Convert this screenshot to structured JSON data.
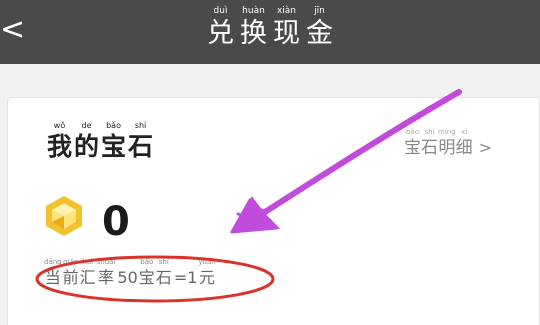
{
  "header": {
    "back_icon": "chevron-left-icon",
    "back_glyph": "<",
    "title": [
      {
        "py": "duì",
        "hz": "兑"
      },
      {
        "py": "huàn",
        "hz": "换"
      },
      {
        "py": "xiàn",
        "hz": "现"
      },
      {
        "py": "jīn",
        "hz": "金"
      }
    ]
  },
  "card": {
    "heading": [
      {
        "py": "wǒ",
        "hz": "我"
      },
      {
        "py": "de",
        "hz": "的"
      },
      {
        "py": "bǎo",
        "hz": "宝"
      },
      {
        "py": "shí",
        "hz": "石"
      }
    ],
    "detail_link": [
      {
        "py": "bǎo",
        "hz": "宝"
      },
      {
        "py": "shí",
        "hz": "石"
      },
      {
        "py": "míng",
        "hz": "明"
      },
      {
        "py": "xì",
        "hz": "细"
      }
    ],
    "detail_chevron": ">",
    "gem_icon": "gem-icon",
    "gem_count": "0",
    "rate": [
      {
        "py": "dāng",
        "hz": "当"
      },
      {
        "py": "qián",
        "hz": "前"
      },
      {
        "py": "huì",
        "hz": "汇"
      },
      {
        "py": "shuài",
        "hz": "率"
      },
      {
        "plain": "50"
      },
      {
        "py": "bǎo",
        "hz": "宝"
      },
      {
        "py": "shí",
        "hz": "石"
      },
      {
        "plain": "=1"
      },
      {
        "py": "yuán",
        "hz": "元"
      }
    ]
  },
  "annotations": {
    "arrow_color": "#c04bdc",
    "ellipse_color": "#d9342b"
  }
}
